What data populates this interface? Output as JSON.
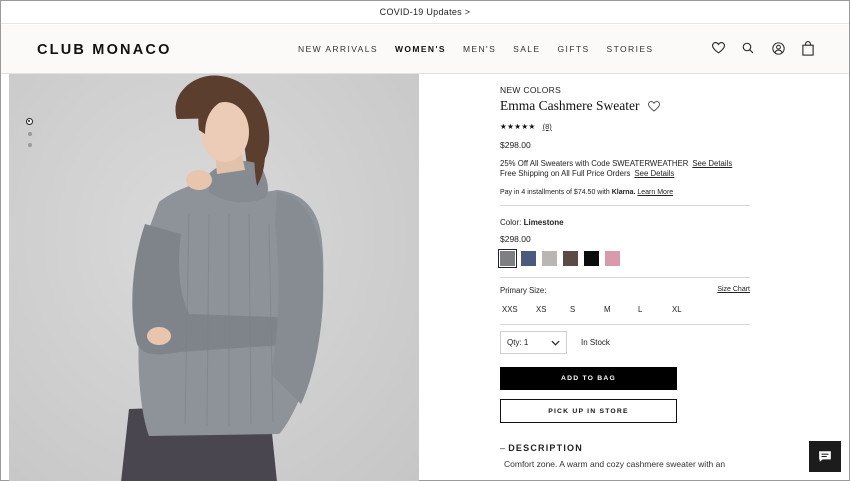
{
  "announcement": {
    "text": "COVID-19 Updates >"
  },
  "header": {
    "logo": "CLUB MONACO",
    "nav": [
      "NEW ARRIVALS",
      "WOMEN'S",
      "MEN'S",
      "SALE",
      "GIFTS",
      "STORIES"
    ],
    "active_nav": "WOMEN'S",
    "icons": [
      "heart-icon",
      "search-icon",
      "account-icon",
      "bag-icon"
    ]
  },
  "gallery": {
    "dot_count": 3,
    "active_dot": 0
  },
  "product": {
    "eyebrow": "NEW COLORS",
    "name": "Emma Cashmere Sweater",
    "stars": "★★★★★",
    "rating": 5,
    "review_count": "(8)",
    "price": "$298.00",
    "promo_line1": "25% Off All Sweaters with Code SWEATERWEATHER",
    "promo_link1": "See Details",
    "promo_line2": "Free Shipping on All Full Price Orders",
    "promo_link2": "See Details",
    "klarna_prefix": "Pay in 4 installments of $74.50 with",
    "klarna_brand": "Klarna.",
    "klarna_link": "Learn More",
    "color_label": "Color:",
    "color_value": "Limestone",
    "color_price": "$298.00",
    "swatches": [
      {
        "name": "Limestone",
        "color": "#7d7f83",
        "selected": true
      },
      {
        "name": "Blue",
        "color": "#4a5a7e"
      },
      {
        "name": "Light Grey",
        "color": "#b9b6b4"
      },
      {
        "name": "Brown",
        "color": "#5a4c44"
      },
      {
        "name": "Black",
        "color": "#0c0c0c"
      },
      {
        "name": "Pink",
        "color": "#d99aab"
      }
    ],
    "size_label": "Primary Size:",
    "size_chart": "Size Chart",
    "sizes": [
      "XXS",
      "XS",
      "S",
      "M",
      "L",
      "XL"
    ],
    "qty_label": "Qty: 1",
    "stock": "In Stock",
    "add_to_bag": "ADD TO BAG",
    "pick_up": "PICK UP IN STORE",
    "description_head": "DESCRIPTION",
    "description_text": "Comfort zone. A warm and cozy cashmere sweater with an"
  }
}
